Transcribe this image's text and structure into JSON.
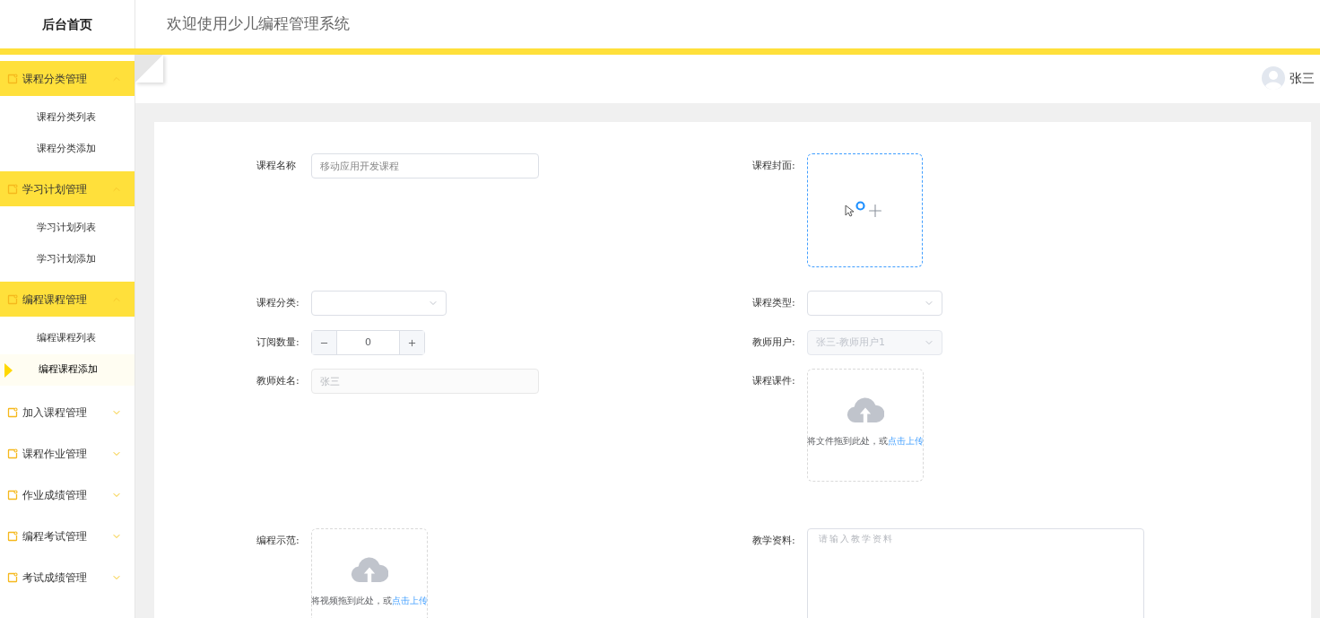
{
  "header": {
    "home": "后台首页",
    "title": "欢迎使用少儿编程管理系统"
  },
  "sidebar": {
    "groups": [
      {
        "title": "课程分类管理",
        "expanded": true,
        "children": [
          {
            "label": "课程分类列表",
            "selected": false
          },
          {
            "label": "课程分类添加",
            "selected": false
          }
        ]
      },
      {
        "title": "学习计划管理",
        "expanded": true,
        "children": [
          {
            "label": "学习计划列表",
            "selected": false
          },
          {
            "label": "学习计划添加",
            "selected": false
          }
        ]
      },
      {
        "title": "编程课程管理",
        "expanded": true,
        "children": [
          {
            "label": "编程课程列表",
            "selected": false
          },
          {
            "label": "编程课程添加",
            "selected": true
          }
        ]
      },
      {
        "title": "加入课程管理",
        "expanded": false
      },
      {
        "title": "课程作业管理",
        "expanded": false
      },
      {
        "title": "作业成绩管理",
        "expanded": false
      },
      {
        "title": "编程考试管理",
        "expanded": false
      },
      {
        "title": "考试成绩管理",
        "expanded": false
      }
    ]
  },
  "user": {
    "name": "张三"
  },
  "form": {
    "rows": [
      {
        "left": {
          "kind": "text",
          "label": "课程名称",
          "value": "移动应用开发课程",
          "disabled": false
        },
        "right": {
          "kind": "upload-image",
          "label": "课程封面:"
        }
      },
      {
        "left": {
          "kind": "select",
          "label": "课程分类:"
        },
        "right": {
          "kind": "select",
          "label": "课程类型:"
        }
      },
      {
        "left": {
          "kind": "number",
          "label": "订阅数量:",
          "value": "0"
        },
        "right": {
          "kind": "select",
          "label": "教师用户:",
          "value": "张三-教师用户1",
          "disabled": true
        }
      },
      {
        "left": {
          "kind": "text",
          "label": "教师姓名:",
          "value": "张三",
          "disabled": true
        },
        "right": {
          "kind": "upload-file",
          "label": "课程课件:",
          "text": "将文件拖到此处，或",
          "link": "点击上传"
        }
      },
      {
        "left": {
          "kind": "upload-file",
          "label": "编程示范:",
          "text": "将视频拖到此处，或",
          "link": "点击上传"
        },
        "right": {
          "kind": "textarea",
          "label": "教学资料:",
          "placeholder": "请输入教学资料"
        }
      }
    ]
  }
}
